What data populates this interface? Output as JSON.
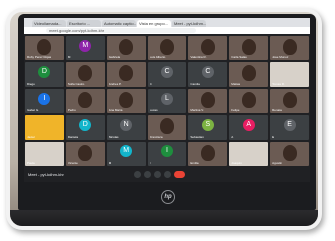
{
  "browser": {
    "tabs": [
      "Videollamada...",
      "Escritorio ...",
      "Automatic captio...",
      "Vista en grupo...",
      "Meet - pyt-kdhm..."
    ],
    "active_tab": 3,
    "url": "meet.google.com/pyt-kdhm-khr"
  },
  "meeting": {
    "title": "Meet - pyt-kdhm-khr",
    "participants": [
      {
        "name": "Ruby Perez Rojas",
        "kind": "video"
      },
      {
        "name": "M",
        "kind": "letter",
        "letter": "M",
        "color": "#8e24aa"
      },
      {
        "name": "Gabriela",
        "kind": "video"
      },
      {
        "name": "Luis Alberto",
        "kind": "video"
      },
      {
        "name": "Valentina R.",
        "kind": "video"
      },
      {
        "name": "Carla Salas",
        "kind": "video"
      },
      {
        "name": "Jose Munoz",
        "kind": "video"
      },
      {
        "name": "Diego",
        "kind": "letter",
        "letter": "D",
        "color": "#1e8e3e"
      },
      {
        "name": "Sofia Castro",
        "kind": "video"
      },
      {
        "name": "Andres P.",
        "kind": "video"
      },
      {
        "name": "C",
        "kind": "letter",
        "letter": "C",
        "color": "#5f6368"
      },
      {
        "name": "Camila",
        "kind": "letter",
        "letter": "C",
        "color": "#5f6368"
      },
      {
        "name": "Matias",
        "kind": "video"
      },
      {
        "name": "Tomas R.",
        "kind": "light"
      },
      {
        "name": "Isabel G.",
        "kind": "letter",
        "letter": "I",
        "color": "#1a73e8"
      },
      {
        "name": "Pedro",
        "kind": "video"
      },
      {
        "name": "Ana Maria",
        "kind": "video"
      },
      {
        "name": "Lucas",
        "kind": "letter",
        "letter": "L",
        "color": "#5f6368"
      },
      {
        "name": "Martina V.",
        "kind": "video"
      },
      {
        "name": "Felipe",
        "kind": "video"
      },
      {
        "name": "Renata",
        "kind": "video"
      },
      {
        "name": "Javier",
        "kind": "yellow"
      },
      {
        "name": "Daniela",
        "kind": "letter",
        "letter": "D",
        "color": "#12b5cb"
      },
      {
        "name": "Nicolas",
        "kind": "letter",
        "letter": "N",
        "color": "#5f6368"
      },
      {
        "name": "Francisca",
        "kind": "video"
      },
      {
        "name": "Sebastian",
        "kind": "letter",
        "letter": "S",
        "color": "#7cb342"
      },
      {
        "name": "A",
        "kind": "letter",
        "letter": "A",
        "color": "#e91e63"
      },
      {
        "name": "E",
        "kind": "letter",
        "letter": "E",
        "color": "#5f6368"
      },
      {
        "name": "Paula",
        "kind": "light"
      },
      {
        "name": "Vicente",
        "kind": "video"
      },
      {
        "name": "M",
        "kind": "letter",
        "letter": "M",
        "color": "#12b5cb"
      },
      {
        "name": "I",
        "kind": "letter",
        "letter": "I",
        "color": "#1e8e3e"
      },
      {
        "name": "Emilia",
        "kind": "video"
      },
      {
        "name": "Joaquin",
        "kind": "light"
      },
      {
        "name": "Agustin",
        "kind": "video"
      }
    ]
  },
  "laptop": {
    "brand": "hp"
  }
}
